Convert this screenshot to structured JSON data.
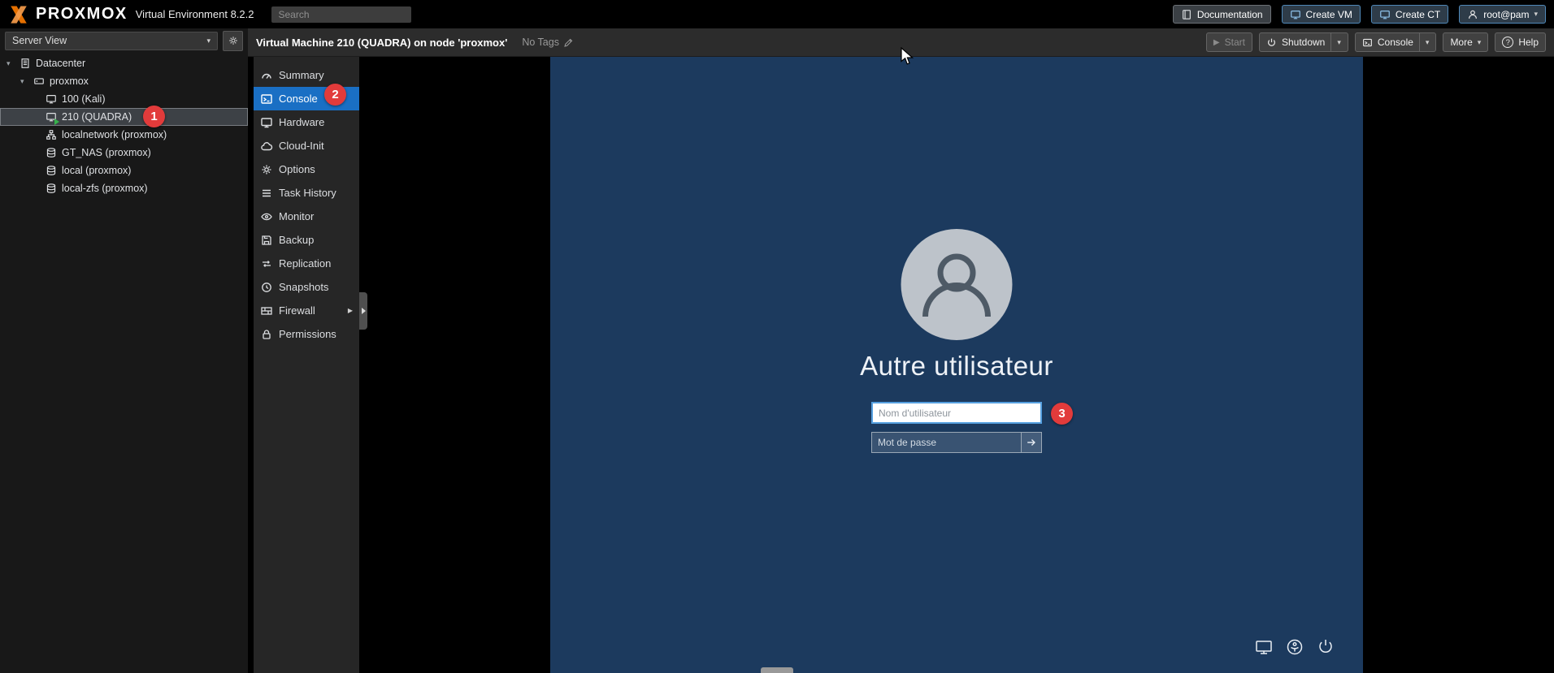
{
  "header": {
    "brand": "PROXMOX",
    "version": "Virtual Environment 8.2.2",
    "search_placeholder": "Search",
    "documentation_label": "Documentation",
    "create_vm_label": "Create VM",
    "create_ct_label": "Create CT",
    "user_label": "root@pam"
  },
  "toolbar": {
    "title": "Virtual Machine 210 (QUADRA) on node 'proxmox'",
    "tags_label": "No Tags",
    "start_label": "Start",
    "shutdown_label": "Shutdown",
    "console_label": "Console",
    "more_label": "More",
    "help_label": "Help"
  },
  "sidebar": {
    "view_label": "Server View",
    "tree": [
      {
        "label": "Datacenter",
        "icon": "server-icon"
      },
      {
        "label": "proxmox",
        "icon": "node-icon"
      },
      {
        "label": "100 (Kali)",
        "icon": "vm-icon"
      },
      {
        "label": "210 (QUADRA)",
        "icon": "vm-running-icon",
        "selected": true
      },
      {
        "label": "localnetwork (proxmox)",
        "icon": "network-icon"
      },
      {
        "label": "GT_NAS (proxmox)",
        "icon": "storage-icon"
      },
      {
        "label": "local (proxmox)",
        "icon": "storage-icon"
      },
      {
        "label": "local-zfs (proxmox)",
        "icon": "storage-icon"
      }
    ]
  },
  "menu": {
    "items": [
      {
        "label": "Summary",
        "icon": "gauge-icon"
      },
      {
        "label": "Console",
        "icon": "terminal-icon",
        "selected": true
      },
      {
        "label": "Hardware",
        "icon": "display-icon"
      },
      {
        "label": "Cloud-Init",
        "icon": "cloud-icon"
      },
      {
        "label": "Options",
        "icon": "gear-icon"
      },
      {
        "label": "Task History",
        "icon": "list-icon"
      },
      {
        "label": "Monitor",
        "icon": "eye-icon"
      },
      {
        "label": "Backup",
        "icon": "floppy-icon"
      },
      {
        "label": "Replication",
        "icon": "sync-icon"
      },
      {
        "label": "Snapshots",
        "icon": "history-icon"
      },
      {
        "label": "Firewall",
        "icon": "wall-icon",
        "has_submenu": true
      },
      {
        "label": "Permissions",
        "icon": "lock-icon"
      }
    ]
  },
  "vm_screen": {
    "other_user_label": "Autre utilisateur",
    "username_placeholder": "Nom d'utilisateur",
    "password_placeholder": "Mot de passe"
  },
  "annotations": {
    "step1": "1",
    "step2": "2",
    "step3": "3"
  },
  "colors": {
    "accent": "#1a6fc4",
    "badge_red": "#e23b3b",
    "vm_background": "#1c3a5e",
    "brand_orange": "#e57000"
  }
}
